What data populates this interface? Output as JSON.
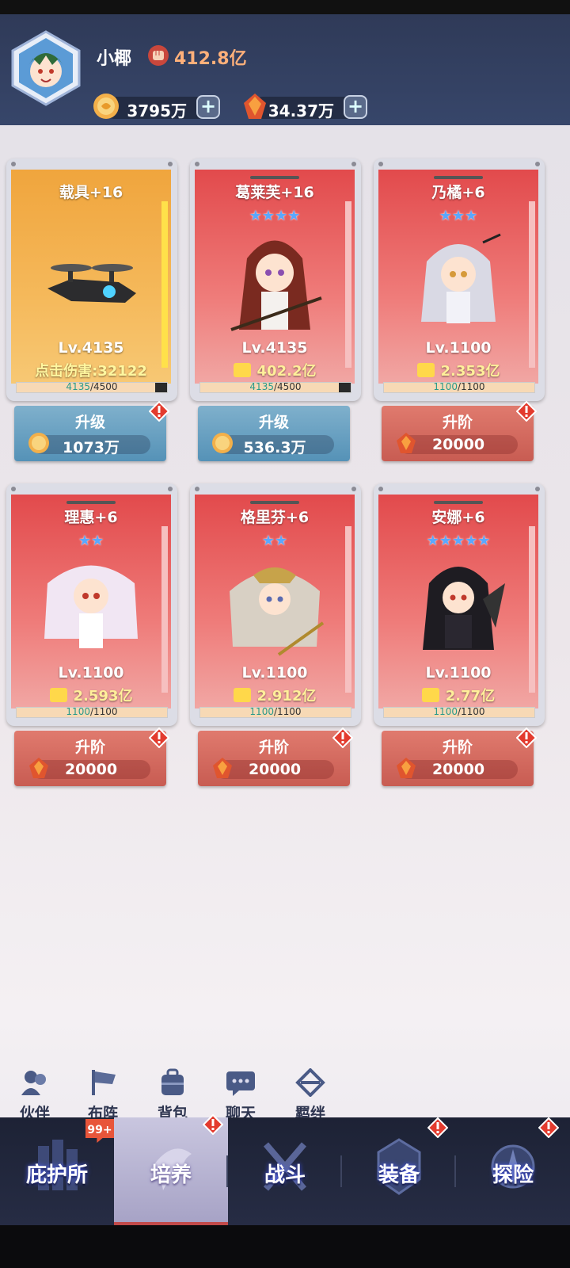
{
  "profile": {
    "name": "小椰",
    "power": "412.8亿",
    "currencies": [
      {
        "icon": "coin-icon",
        "value": "3795万"
      },
      {
        "icon": "crystal-icon",
        "value": "34.37万"
      }
    ]
  },
  "cards": [
    {
      "name": "载具+16",
      "stars": "",
      "level": "Lv.4135",
      "stat": "点击伤害:32122",
      "stat_type": "damage",
      "progress_cur": "4135",
      "progress_max": "/4500",
      "progress": 0.919,
      "theme": "gold",
      "button": {
        "label": "升级",
        "cost": "1073万",
        "cost_icon": "coin-icon",
        "style": "blue"
      }
    },
    {
      "name": "葛莱芙+16",
      "stars": "★★★★",
      "level": "Lv.4135",
      "stat": "402.2亿",
      "stat_type": "power",
      "progress_cur": "4135",
      "progress_max": "/4500",
      "progress": 0.919,
      "theme": "red",
      "button": {
        "label": "升级",
        "cost": "536.3万",
        "cost_icon": "coin-icon",
        "style": "blue"
      }
    },
    {
      "name": "乃橘+6",
      "stars": "★★★",
      "level": "Lv.1100",
      "stat": "2.353亿",
      "stat_type": "power",
      "progress_cur": "1100",
      "progress_max": "/1100",
      "progress": 1.0,
      "theme": "red",
      "button": {
        "label": "升阶",
        "cost": "20000",
        "cost_icon": "crystal-icon",
        "style": "red"
      }
    },
    {
      "name": "理惠+6",
      "stars": "★★",
      "level": "Lv.1100",
      "stat": "2.593亿",
      "stat_type": "power",
      "progress_cur": "1100",
      "progress_max": "/1100",
      "progress": 1.0,
      "theme": "red",
      "button": {
        "label": "升阶",
        "cost": "20000",
        "cost_icon": "crystal-icon",
        "style": "red"
      }
    },
    {
      "name": "格里芬+6",
      "stars": "★★",
      "level": "Lv.1100",
      "stat": "2.912亿",
      "stat_type": "power",
      "progress_cur": "1100",
      "progress_max": "/1100",
      "progress": 1.0,
      "theme": "red",
      "button": {
        "label": "升阶",
        "cost": "20000",
        "cost_icon": "crystal-icon",
        "style": "red"
      }
    },
    {
      "name": "安娜+6",
      "stars": "★★★★★",
      "level": "Lv.1100",
      "stat": "2.77亿",
      "stat_type": "power",
      "progress_cur": "1100",
      "progress_max": "/1100",
      "progress": 1.0,
      "theme": "red",
      "button": {
        "label": "升阶",
        "cost": "20000",
        "cost_icon": "crystal-icon",
        "style": "red"
      }
    }
  ],
  "quick_menu": [
    {
      "label": "伙伴",
      "icon": "partner-icon"
    },
    {
      "label": "布阵",
      "icon": "flag-icon"
    },
    {
      "label": "背包",
      "icon": "backpack-icon"
    },
    {
      "label": "聊天",
      "icon": "chat-icon"
    },
    {
      "label": "羁绊",
      "icon": "bond-icon"
    }
  ],
  "nav": {
    "badge": "99+",
    "tabs": [
      {
        "label": "庇护所",
        "active": false,
        "alert": false
      },
      {
        "label": "培养",
        "active": true,
        "alert": true
      },
      {
        "label": "战斗",
        "active": false,
        "alert": false
      },
      {
        "label": "装备",
        "active": false,
        "alert": true
      },
      {
        "label": "探险",
        "active": false,
        "alert": true
      }
    ]
  },
  "colors": {
    "accent_red": "#e24a4c",
    "header_bg": "#2f3a58",
    "nav_bg": "#1d2235",
    "progress_text": "#2a9a8a"
  }
}
